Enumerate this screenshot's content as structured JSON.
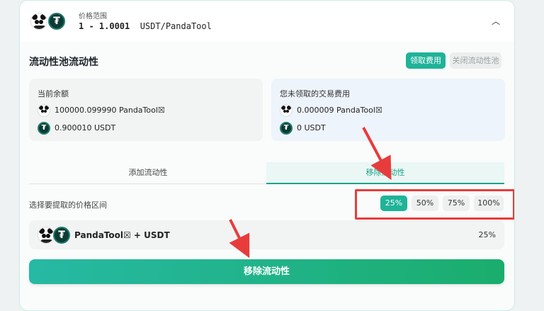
{
  "header": {
    "price_range_label": "价格范围",
    "price_range_value": "1 - 1.0001",
    "pair_symbol": "USDT/PandaTool",
    "collapse_icon": "chevron-up-icon"
  },
  "liquidity": {
    "title": "流动性池流动性",
    "claim_fees_label": "领取费用",
    "close_pool_label": "关闭流动性池"
  },
  "balance_box": {
    "label": "当前余额",
    "token_amount": "100000.099990 PandaTool☒",
    "usdt_amount": "0.900010 USDT"
  },
  "fees_box": {
    "label": "您未领取的交易费用",
    "token_amount": "0.000009 PandaTool☒",
    "usdt_amount": "0 USDT"
  },
  "tabs": {
    "add": "添加流动性",
    "remove": "移除流动性"
  },
  "selector": {
    "label": "选择要提取的价格区间",
    "options": [
      "25%",
      "50%",
      "75%",
      "100%"
    ],
    "selected": "25%"
  },
  "pair": {
    "label": "PandaTool☒ + USDT",
    "percent": "25%"
  },
  "action": {
    "remove_label": "移除流动性"
  },
  "colors": {
    "accent": "#1fb398",
    "highlight": "#e83c3c"
  }
}
